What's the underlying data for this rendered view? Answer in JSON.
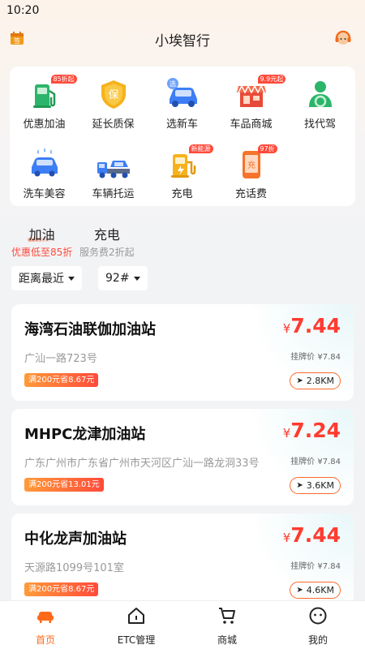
{
  "status": {
    "time": "10:20"
  },
  "header": {
    "title": "小埃智行"
  },
  "services": [
    {
      "label": "优惠加油",
      "tag": "85折起",
      "icon": "fuel-pump-icon"
    },
    {
      "label": "延长质保",
      "tag": "",
      "icon": "warranty-shield-icon"
    },
    {
      "label": "选新车",
      "tag": "",
      "icon": "new-car-icon"
    },
    {
      "label": "车品商城",
      "tag": "9.9元起",
      "icon": "shop-icon"
    },
    {
      "label": "找代驾",
      "tag": "",
      "icon": "driver-icon"
    },
    {
      "label": "洗车美容",
      "tag": "",
      "icon": "car-wash-icon"
    },
    {
      "label": "车辆托运",
      "tag": "",
      "icon": "tow-truck-icon"
    },
    {
      "label": "充电",
      "tag": "新能源",
      "icon": "charging-pile-icon"
    },
    {
      "label": "充话费",
      "tag": "97折",
      "icon": "phone-recharge-icon"
    }
  ],
  "categories": [
    {
      "label": "加油",
      "sub": "优惠低至85折"
    },
    {
      "label": "充电",
      "sub": "服务费2折起"
    }
  ],
  "filters": {
    "sort": "距离最近",
    "fuel": "92#"
  },
  "stations": [
    {
      "name": "海湾石油联伽加油站",
      "address": "广汕一路723号",
      "promo": "满200元省8.67元",
      "currency": "¥",
      "price": "7.44",
      "listed": "挂牌价 ¥7.84",
      "distance": "2.8KM"
    },
    {
      "name": "MHPC龙津加油站",
      "address": "广东广州市广东省广州市天河区广汕一路龙洞33号",
      "promo": "满200元省13.01元",
      "currency": "¥",
      "price": "7.24",
      "listed": "挂牌价 ¥7.84",
      "distance": "3.6KM"
    },
    {
      "name": "中化龙声加油站",
      "address": "天源路1099号101室",
      "promo": "满200元省8.67元",
      "currency": "¥",
      "price": "7.44",
      "listed": "挂牌价 ¥7.84",
      "distance": "4.6KM"
    }
  ],
  "tabbar": [
    {
      "label": "首页",
      "icon": "home-sofa-icon"
    },
    {
      "label": "ETC管理",
      "icon": "etc-house-icon"
    },
    {
      "label": "商城",
      "icon": "cart-icon"
    },
    {
      "label": "我的",
      "icon": "profile-icon"
    }
  ],
  "colors": {
    "accent": "#ff6a1a",
    "price": "#ff3b30",
    "tag": "#ff4a3a"
  }
}
